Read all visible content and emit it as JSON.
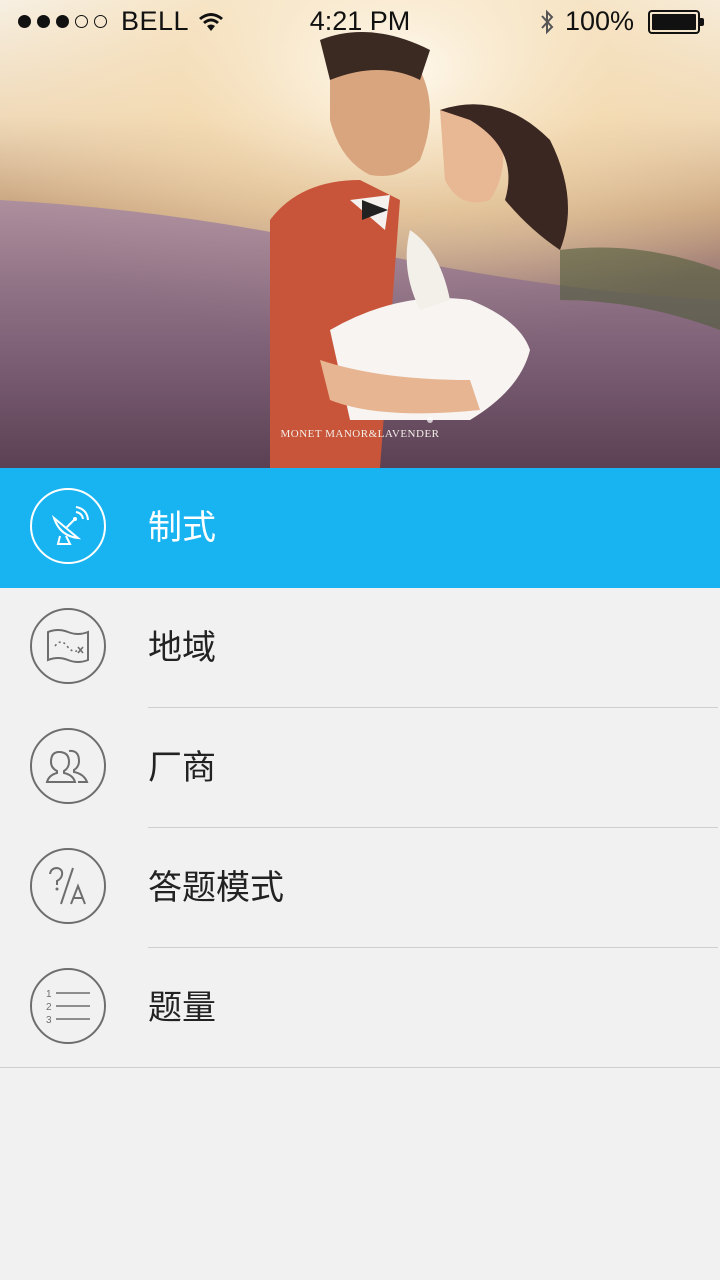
{
  "status_bar": {
    "carrier": "BELL",
    "time": "4:21 PM",
    "battery": "100%",
    "battery_level": 1.0,
    "signal_bars": 3,
    "signal_total": 5
  },
  "hero": {
    "caption": "MONET MANOR&LAVENDER"
  },
  "menu": {
    "items": [
      {
        "label": "制式",
        "icon": "satellite-dish-icon",
        "active": true
      },
      {
        "label": "地域",
        "icon": "map-icon",
        "active": false
      },
      {
        "label": "厂商",
        "icon": "users-icon",
        "active": false
      },
      {
        "label": "答题模式",
        "icon": "question-answer-icon",
        "active": false
      },
      {
        "label": "题量",
        "icon": "numbered-list-icon",
        "active": false
      }
    ],
    "list_numbers": [
      "1",
      "2",
      "3"
    ]
  },
  "colors": {
    "accent": "#18b4f2",
    "background": "#f1f1f1",
    "divider": "#cfcfcf",
    "icon_stroke": "#6e6e6e"
  }
}
